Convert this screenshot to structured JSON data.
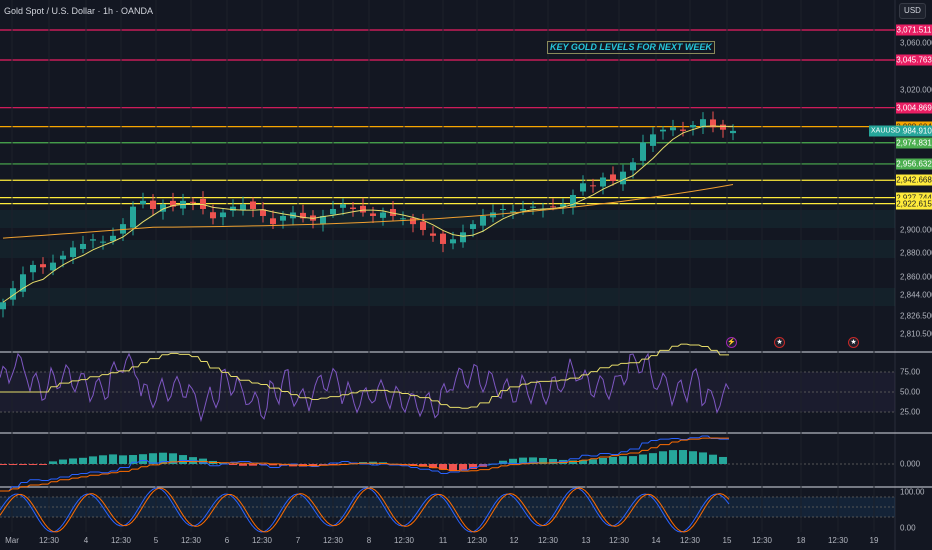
{
  "header": {
    "title": "Gold Spot / U.S. Dollar · 1h · OANDA",
    "currency_button": "USD"
  },
  "annotation": "KEY GOLD LEVELS FOR NEXT WEEK",
  "symbol_tag": "XAUUSD",
  "price_levels": [
    {
      "value": 3071.511,
      "label": "3,071.511",
      "color": "#e91e63"
    },
    {
      "value": 3045.763,
      "label": "3,045.763",
      "color": "#e91e63"
    },
    {
      "value": 3004.869,
      "label": "3,004.869",
      "color": "#e91e63"
    },
    {
      "value": 2988.604,
      "label": "2,988.604",
      "color": "#f7a600"
    },
    {
      "value": 2974.831,
      "label": "2,974.831",
      "color": "#4caf50"
    },
    {
      "value": 2956.632,
      "label": "2,956.632",
      "color": "#4caf50"
    },
    {
      "value": 2942.668,
      "label": "2,942.668",
      "color": "#ffeb3b"
    },
    {
      "value": 2927.744,
      "label": "2,927.744",
      "color": "#ffeb3b"
    },
    {
      "value": 2922.615,
      "label": "2,922.615",
      "color": "#ffeb3b"
    }
  ],
  "current_price": {
    "value": 2984.91,
    "label": "2,984.910",
    "color": "#26a69a"
  },
  "price_ticks": [
    {
      "v": 3060,
      "t": "3,060.000"
    },
    {
      "v": 3020,
      "t": "3,020.000"
    },
    {
      "v": 2900,
      "t": "2,900.000"
    },
    {
      "v": 2880,
      "t": "2,880.000"
    },
    {
      "v": 2860,
      "t": "2,860.000"
    },
    {
      "v": 2844,
      "t": "2,844.000"
    },
    {
      "v": 2826.5,
      "t": "2,826.500"
    },
    {
      "v": 2810.5,
      "t": "2,810.500"
    }
  ],
  "rsi_ticks": [
    "75.00",
    "50.00",
    "25.00"
  ],
  "macd_ticks": [
    "0.000"
  ],
  "stoch_ticks": [
    "100.00",
    "0.00"
  ],
  "time_labels": [
    "Mar",
    "12:30",
    "4",
    "12:30",
    "5",
    "12:30",
    "6",
    "12:30",
    "7",
    "12:30",
    "8",
    "12:30",
    "11",
    "12:30",
    "12",
    "12:30",
    "13",
    "12:30",
    "14",
    "12:30",
    "15",
    "12:30",
    "18",
    "12:30",
    "19"
  ],
  "events": [
    "lightning-icon",
    "us-flag-icon",
    "us-flag-icon"
  ],
  "chart_data": {
    "type": "candlestick",
    "title": "Gold Spot / U.S. Dollar · 1h · OANDA",
    "ylim": [
      2810.5,
      3080
    ],
    "close": [
      2838,
      2850,
      2862,
      2870,
      2868,
      2872,
      2878,
      2885,
      2888,
      2892,
      2890,
      2895,
      2905,
      2920,
      2925,
      2918,
      2922,
      2920,
      2925,
      2924,
      2918,
      2910,
      2915,
      2920,
      2922,
      2918,
      2912,
      2905,
      2912,
      2915,
      2910,
      2908,
      2912,
      2918,
      2922,
      2918,
      2915,
      2912,
      2915,
      2912,
      2910,
      2905,
      2900,
      2895,
      2888,
      2892,
      2898,
      2905,
      2912,
      2915,
      2918,
      2916,
      2918,
      2920,
      2918,
      2920,
      2922,
      2930,
      2940,
      2938,
      2945,
      2942,
      2950,
      2958,
      2975,
      2982,
      2986,
      2988,
      2985,
      2990,
      2995,
      2988,
      2986,
      2985
    ]
  }
}
